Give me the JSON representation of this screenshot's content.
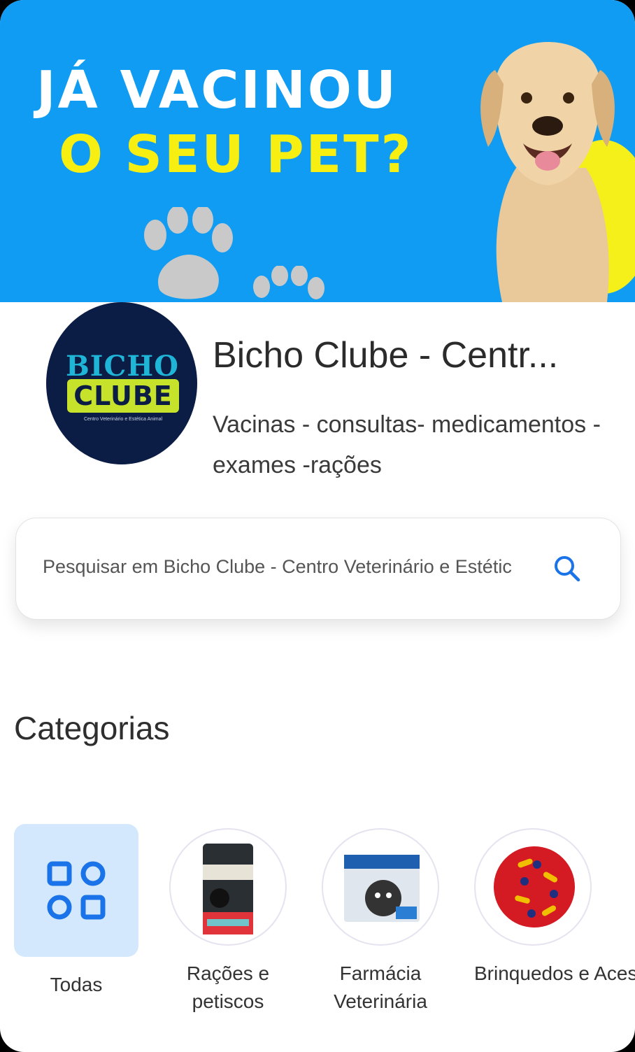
{
  "banner": {
    "line1": "JÁ VACINOU",
    "line2": "O SEU PET?",
    "colors": {
      "background": "#109cf2",
      "line1": "#ffffff",
      "line2": "#f7ef12"
    }
  },
  "store": {
    "logo_text_top": "BICHO",
    "logo_text_bottom": "CLUBE",
    "logo_subtitle": "Centro Veterinário e Estética Animal",
    "name": "Bicho Clube - Centr...",
    "description": "Vacinas - consultas- medicamentos - exames -rações"
  },
  "search": {
    "placeholder": "Pesquisar em Bicho Clube - Centro Veterinário e Estétic",
    "icon": "search-icon",
    "accent": "#1a73e8"
  },
  "categories": {
    "title": "Categorias",
    "items": [
      {
        "label": "Todas",
        "icon": "grid-icon",
        "selected": true
      },
      {
        "label": "Rações e petiscos",
        "icon": "pet-food-bag-image"
      },
      {
        "label": "Farmácia Veterinária",
        "icon": "medicine-box-image"
      },
      {
        "label": "Brinquedos e Acessórios...",
        "icon": "toy-ball-image"
      }
    ]
  }
}
